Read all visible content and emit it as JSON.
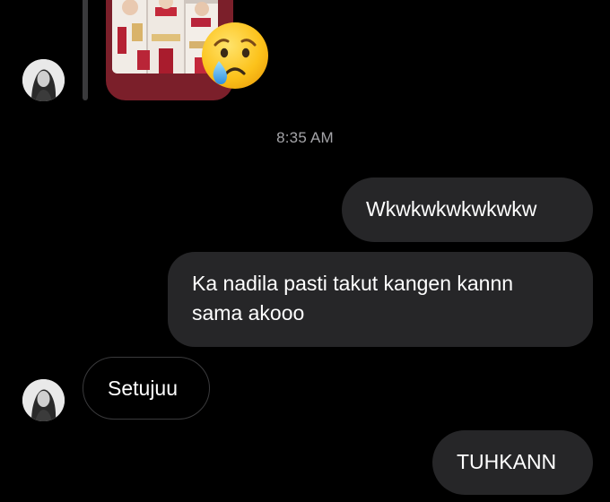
{
  "conversation": {
    "timestamp": "8:35 AM",
    "shared_photo": {
      "reaction_icon": "crying-face-emoji"
    },
    "messages": [
      {
        "direction": "outgoing",
        "text": "Wkwkwkwkwkwkw"
      },
      {
        "direction": "outgoing",
        "lines": [
          "Ka nadila pasti takut kangen kannn",
          "sama akooo"
        ]
      },
      {
        "direction": "incoming",
        "text": "Setujuu"
      },
      {
        "direction": "outgoing",
        "text": "TUHKANN"
      }
    ]
  },
  "colors": {
    "background": "#000000",
    "outgoing_bubble": "#262628",
    "incoming_border": "#3a3a3c",
    "photo_frame": "#7b1f2a",
    "timestamp_text": "#a4a4a8"
  }
}
